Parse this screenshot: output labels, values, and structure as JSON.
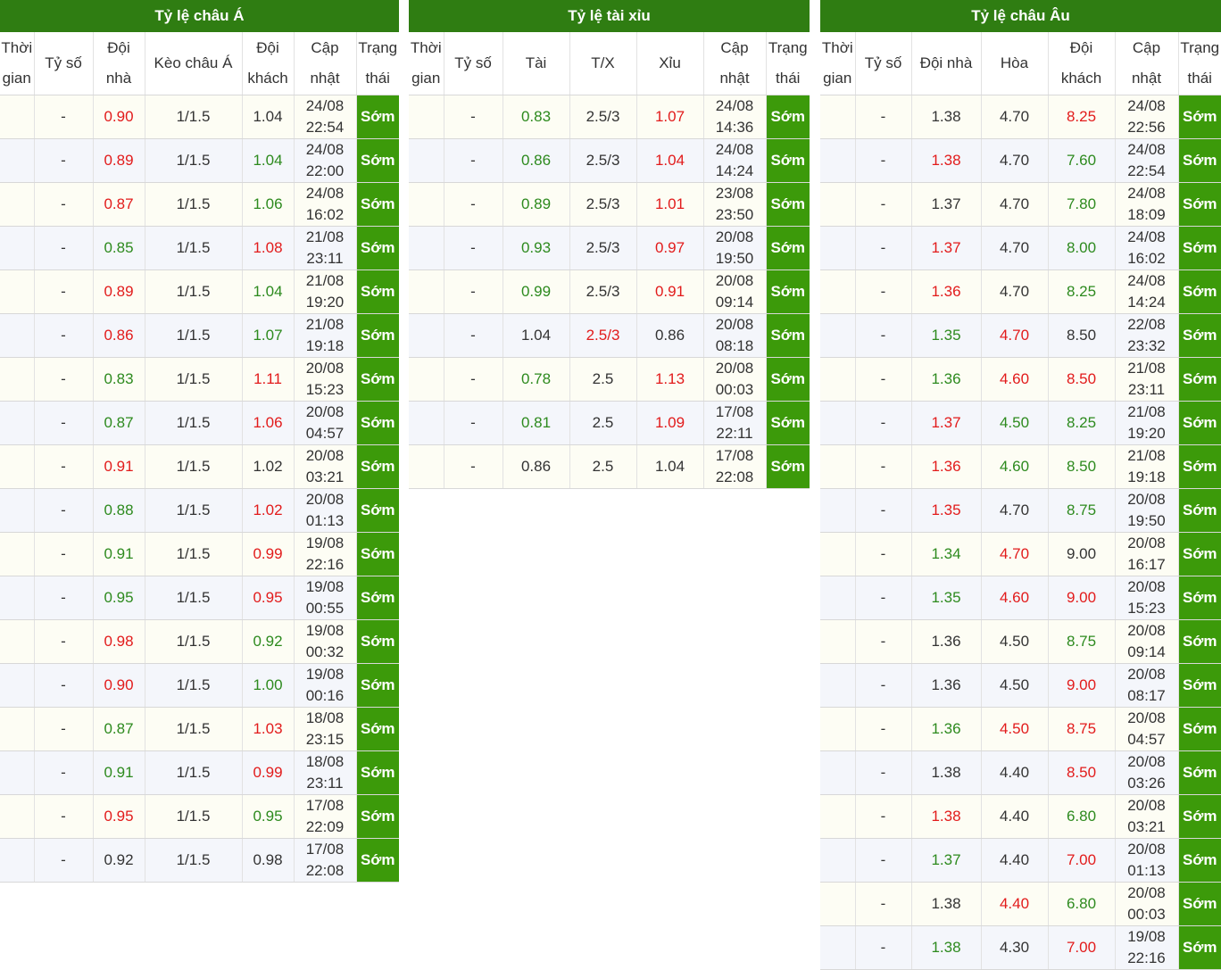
{
  "asian": {
    "title": "Tỷ lệ châu Á",
    "headers": [
      "Thời\ngian",
      "Tỷ số",
      "Đội\nnhà",
      "Kèo châu Á",
      "Đội\nkhách",
      "Cập\nnhật",
      "Trạng\nthái"
    ],
    "rows": [
      {
        "time": "",
        "score": "-",
        "home": "0.90",
        "home_c": "red",
        "line": "1/1.5",
        "line_c": "plain",
        "away": "1.04",
        "away_c": "plain",
        "updated": "24/08\n22:54",
        "status": "Sớm"
      },
      {
        "time": "",
        "score": "-",
        "home": "0.89",
        "home_c": "red",
        "line": "1/1.5",
        "line_c": "plain",
        "away": "1.04",
        "away_c": "green",
        "updated": "24/08\n22:00",
        "status": "Sớm"
      },
      {
        "time": "",
        "score": "-",
        "home": "0.87",
        "home_c": "red",
        "line": "1/1.5",
        "line_c": "plain",
        "away": "1.06",
        "away_c": "green",
        "updated": "24/08\n16:02",
        "status": "Sớm"
      },
      {
        "time": "",
        "score": "-",
        "home": "0.85",
        "home_c": "green",
        "line": "1/1.5",
        "line_c": "plain",
        "away": "1.08",
        "away_c": "red",
        "updated": "21/08\n23:11",
        "status": "Sớm"
      },
      {
        "time": "",
        "score": "-",
        "home": "0.89",
        "home_c": "red",
        "line": "1/1.5",
        "line_c": "plain",
        "away": "1.04",
        "away_c": "green",
        "updated": "21/08\n19:20",
        "status": "Sớm"
      },
      {
        "time": "",
        "score": "-",
        "home": "0.86",
        "home_c": "red",
        "line": "1/1.5",
        "line_c": "plain",
        "away": "1.07",
        "away_c": "green",
        "updated": "21/08\n19:18",
        "status": "Sớm"
      },
      {
        "time": "",
        "score": "-",
        "home": "0.83",
        "home_c": "green",
        "line": "1/1.5",
        "line_c": "plain",
        "away": "1.11",
        "away_c": "red",
        "updated": "20/08\n15:23",
        "status": "Sớm"
      },
      {
        "time": "",
        "score": "-",
        "home": "0.87",
        "home_c": "green",
        "line": "1/1.5",
        "line_c": "plain",
        "away": "1.06",
        "away_c": "red",
        "updated": "20/08\n04:57",
        "status": "Sớm"
      },
      {
        "time": "",
        "score": "-",
        "home": "0.91",
        "home_c": "red",
        "line": "1/1.5",
        "line_c": "plain",
        "away": "1.02",
        "away_c": "plain",
        "updated": "20/08\n03:21",
        "status": "Sớm"
      },
      {
        "time": "",
        "score": "-",
        "home": "0.88",
        "home_c": "green",
        "line": "1/1.5",
        "line_c": "plain",
        "away": "1.02",
        "away_c": "red",
        "updated": "20/08\n01:13",
        "status": "Sớm"
      },
      {
        "time": "",
        "score": "-",
        "home": "0.91",
        "home_c": "green",
        "line": "1/1.5",
        "line_c": "plain",
        "away": "0.99",
        "away_c": "red",
        "updated": "19/08\n22:16",
        "status": "Sớm"
      },
      {
        "time": "",
        "score": "-",
        "home": "0.95",
        "home_c": "green",
        "line": "1/1.5",
        "line_c": "plain",
        "away": "0.95",
        "away_c": "red",
        "updated": "19/08\n00:55",
        "status": "Sớm"
      },
      {
        "time": "",
        "score": "-",
        "home": "0.98",
        "home_c": "red",
        "line": "1/1.5",
        "line_c": "plain",
        "away": "0.92",
        "away_c": "green",
        "updated": "19/08\n00:32",
        "status": "Sớm"
      },
      {
        "time": "",
        "score": "-",
        "home": "0.90",
        "home_c": "red",
        "line": "1/1.5",
        "line_c": "plain",
        "away": "1.00",
        "away_c": "green",
        "updated": "19/08\n00:16",
        "status": "Sớm"
      },
      {
        "time": "",
        "score": "-",
        "home": "0.87",
        "home_c": "green",
        "line": "1/1.5",
        "line_c": "plain",
        "away": "1.03",
        "away_c": "red",
        "updated": "18/08\n23:15",
        "status": "Sớm"
      },
      {
        "time": "",
        "score": "-",
        "home": "0.91",
        "home_c": "green",
        "line": "1/1.5",
        "line_c": "plain",
        "away": "0.99",
        "away_c": "red",
        "updated": "18/08\n23:11",
        "status": "Sớm"
      },
      {
        "time": "",
        "score": "-",
        "home": "0.95",
        "home_c": "red",
        "line": "1/1.5",
        "line_c": "plain",
        "away": "0.95",
        "away_c": "green",
        "updated": "17/08\n22:09",
        "status": "Sớm"
      },
      {
        "time": "",
        "score": "-",
        "home": "0.92",
        "home_c": "plain",
        "line": "1/1.5",
        "line_c": "plain",
        "away": "0.98",
        "away_c": "plain",
        "updated": "17/08\n22:08",
        "status": "Sớm"
      }
    ]
  },
  "over_under": {
    "title": "Tỷ lệ tài xỉu",
    "headers": [
      "Thời\ngian",
      "Tỷ số",
      "Tài",
      "T/X",
      "Xỉu",
      "Cập\nnhật",
      "Trạng\nthái"
    ],
    "rows": [
      {
        "time": "",
        "score": "-",
        "home": "0.83",
        "home_c": "green",
        "line": "2.5/3",
        "line_c": "plain",
        "away": "1.07",
        "away_c": "red",
        "updated": "24/08\n14:36",
        "status": "Sớm"
      },
      {
        "time": "",
        "score": "-",
        "home": "0.86",
        "home_c": "green",
        "line": "2.5/3",
        "line_c": "plain",
        "away": "1.04",
        "away_c": "red",
        "updated": "24/08\n14:24",
        "status": "Sớm"
      },
      {
        "time": "",
        "score": "-",
        "home": "0.89",
        "home_c": "green",
        "line": "2.5/3",
        "line_c": "plain",
        "away": "1.01",
        "away_c": "red",
        "updated": "23/08\n23:50",
        "status": "Sớm"
      },
      {
        "time": "",
        "score": "-",
        "home": "0.93",
        "home_c": "green",
        "line": "2.5/3",
        "line_c": "plain",
        "away": "0.97",
        "away_c": "red",
        "updated": "20/08\n19:50",
        "status": "Sớm"
      },
      {
        "time": "",
        "score": "-",
        "home": "0.99",
        "home_c": "green",
        "line": "2.5/3",
        "line_c": "plain",
        "away": "0.91",
        "away_c": "red",
        "updated": "20/08\n09:14",
        "status": "Sớm"
      },
      {
        "time": "",
        "score": "-",
        "home": "1.04",
        "home_c": "plain",
        "line": "2.5/3",
        "line_c": "red",
        "away": "0.86",
        "away_c": "plain",
        "updated": "20/08\n08:18",
        "status": "Sớm"
      },
      {
        "time": "",
        "score": "-",
        "home": "0.78",
        "home_c": "green",
        "line": "2.5",
        "line_c": "plain",
        "away": "1.13",
        "away_c": "red",
        "updated": "20/08\n00:03",
        "status": "Sớm"
      },
      {
        "time": "",
        "score": "-",
        "home": "0.81",
        "home_c": "green",
        "line": "2.5",
        "line_c": "plain",
        "away": "1.09",
        "away_c": "red",
        "updated": "17/08\n22:11",
        "status": "Sớm"
      },
      {
        "time": "",
        "score": "-",
        "home": "0.86",
        "home_c": "plain",
        "line": "2.5",
        "line_c": "plain",
        "away": "1.04",
        "away_c": "plain",
        "updated": "17/08\n22:08",
        "status": "Sớm"
      }
    ]
  },
  "european": {
    "title": "Tỷ lệ châu Âu",
    "headers": [
      "Thời\ngian",
      "Tỷ số",
      "Đội nhà",
      "Hòa",
      "Đội\nkhách",
      "Cập\nnhật",
      "Trạng\nthái"
    ],
    "rows": [
      {
        "time": "",
        "score": "-",
        "home": "1.38",
        "home_c": "plain",
        "line": "4.70",
        "line_c": "plain",
        "away": "8.25",
        "away_c": "red",
        "updated": "24/08\n22:56",
        "status": "Sớm"
      },
      {
        "time": "",
        "score": "-",
        "home": "1.38",
        "home_c": "red",
        "line": "4.70",
        "line_c": "plain",
        "away": "7.60",
        "away_c": "green",
        "updated": "24/08\n22:54",
        "status": "Sớm"
      },
      {
        "time": "",
        "score": "-",
        "home": "1.37",
        "home_c": "plain",
        "line": "4.70",
        "line_c": "plain",
        "away": "7.80",
        "away_c": "green",
        "updated": "24/08\n18:09",
        "status": "Sớm"
      },
      {
        "time": "",
        "score": "-",
        "home": "1.37",
        "home_c": "red",
        "line": "4.70",
        "line_c": "plain",
        "away": "8.00",
        "away_c": "green",
        "updated": "24/08\n16:02",
        "status": "Sớm"
      },
      {
        "time": "",
        "score": "-",
        "home": "1.36",
        "home_c": "red",
        "line": "4.70",
        "line_c": "plain",
        "away": "8.25",
        "away_c": "green",
        "updated": "24/08\n14:24",
        "status": "Sớm"
      },
      {
        "time": "",
        "score": "-",
        "home": "1.35",
        "home_c": "green",
        "line": "4.70",
        "line_c": "red",
        "away": "8.50",
        "away_c": "plain",
        "updated": "22/08\n23:32",
        "status": "Sớm"
      },
      {
        "time": "",
        "score": "-",
        "home": "1.36",
        "home_c": "green",
        "line": "4.60",
        "line_c": "red",
        "away": "8.50",
        "away_c": "red",
        "updated": "21/08\n23:11",
        "status": "Sớm"
      },
      {
        "time": "",
        "score": "-",
        "home": "1.37",
        "home_c": "red",
        "line": "4.50",
        "line_c": "green",
        "away": "8.25",
        "away_c": "green",
        "updated": "21/08\n19:20",
        "status": "Sớm"
      },
      {
        "time": "",
        "score": "-",
        "home": "1.36",
        "home_c": "red",
        "line": "4.60",
        "line_c": "green",
        "away": "8.50",
        "away_c": "green",
        "updated": "21/08\n19:18",
        "status": "Sớm"
      },
      {
        "time": "",
        "score": "-",
        "home": "1.35",
        "home_c": "red",
        "line": "4.70",
        "line_c": "plain",
        "away": "8.75",
        "away_c": "green",
        "updated": "20/08\n19:50",
        "status": "Sớm"
      },
      {
        "time": "",
        "score": "-",
        "home": "1.34",
        "home_c": "green",
        "line": "4.70",
        "line_c": "red",
        "away": "9.00",
        "away_c": "plain",
        "updated": "20/08\n16:17",
        "status": "Sớm"
      },
      {
        "time": "",
        "score": "-",
        "home": "1.35",
        "home_c": "green",
        "line": "4.60",
        "line_c": "red",
        "away": "9.00",
        "away_c": "red",
        "updated": "20/08\n15:23",
        "status": "Sớm"
      },
      {
        "time": "",
        "score": "-",
        "home": "1.36",
        "home_c": "plain",
        "line": "4.50",
        "line_c": "plain",
        "away": "8.75",
        "away_c": "green",
        "updated": "20/08\n09:14",
        "status": "Sớm"
      },
      {
        "time": "",
        "score": "-",
        "home": "1.36",
        "home_c": "plain",
        "line": "4.50",
        "line_c": "plain",
        "away": "9.00",
        "away_c": "red",
        "updated": "20/08\n08:17",
        "status": "Sớm"
      },
      {
        "time": "",
        "score": "-",
        "home": "1.36",
        "home_c": "green",
        "line": "4.50",
        "line_c": "red",
        "away": "8.75",
        "away_c": "red",
        "updated": "20/08\n04:57",
        "status": "Sớm"
      },
      {
        "time": "",
        "score": "-",
        "home": "1.38",
        "home_c": "plain",
        "line": "4.40",
        "line_c": "plain",
        "away": "8.50",
        "away_c": "red",
        "updated": "20/08\n03:26",
        "status": "Sớm"
      },
      {
        "time": "",
        "score": "-",
        "home": "1.38",
        "home_c": "red",
        "line": "4.40",
        "line_c": "plain",
        "away": "6.80",
        "away_c": "green",
        "updated": "20/08\n03:21",
        "status": "Sớm"
      },
      {
        "time": "",
        "score": "-",
        "home": "1.37",
        "home_c": "green",
        "line": "4.40",
        "line_c": "plain",
        "away": "7.00",
        "away_c": "red",
        "updated": "20/08\n01:13",
        "status": "Sớm"
      },
      {
        "time": "",
        "score": "-",
        "home": "1.38",
        "home_c": "plain",
        "line": "4.40",
        "line_c": "red",
        "away": "6.80",
        "away_c": "green",
        "updated": "20/08\n00:03",
        "status": "Sớm"
      },
      {
        "time": "",
        "score": "-",
        "home": "1.38",
        "home_c": "green",
        "line": "4.30",
        "line_c": "plain",
        "away": "7.00",
        "away_c": "red",
        "updated": "19/08\n22:16",
        "status": "Sớm"
      }
    ]
  },
  "colors": {
    "header_green": "#2f7d12",
    "status_green": "#3c9a0a",
    "odds_red": "#e21b1b",
    "odds_green": "#2d8a1e"
  }
}
